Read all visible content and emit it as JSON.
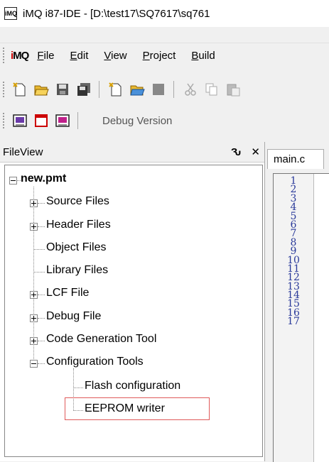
{
  "window": {
    "title": "iMQ i87-IDE - [D:\\test17\\SQ7617\\sq761",
    "logo_text": "iMQ"
  },
  "menu": {
    "logo": "iMQ",
    "items": [
      {
        "label": "File",
        "underline": "F",
        "rest": "ile"
      },
      {
        "label": "Edit",
        "underline": "E",
        "rest": "dit"
      },
      {
        "label": "View",
        "underline": "V",
        "rest": "iew"
      },
      {
        "label": "Project",
        "underline": "P",
        "rest": "roject"
      },
      {
        "label": "Build",
        "underline": "B",
        "rest": "uild"
      }
    ]
  },
  "toolbar2": {
    "config_label": "Debug Version"
  },
  "fileview": {
    "title": "FileView",
    "pin": "Ԅ",
    "close": "✕"
  },
  "tree": {
    "root": "new.pmt",
    "items": [
      "Source Files",
      "Header Files",
      "Object Files",
      "Library Files",
      "LCF File",
      "Debug File",
      "Code Generation Tool",
      "Configuration Tools"
    ],
    "children": [
      "Flash configuration",
      "EEPROM writer"
    ]
  },
  "editor": {
    "tab": "main.c",
    "line_numbers": [
      "1",
      "2",
      "3",
      "4",
      "5",
      "6",
      "7",
      "8",
      "9",
      "10",
      "11",
      "12",
      "13",
      "14",
      "15",
      "16",
      "17"
    ]
  },
  "colors": {
    "highlight": "#e05a5a",
    "line_number": "#2a3a9a"
  }
}
